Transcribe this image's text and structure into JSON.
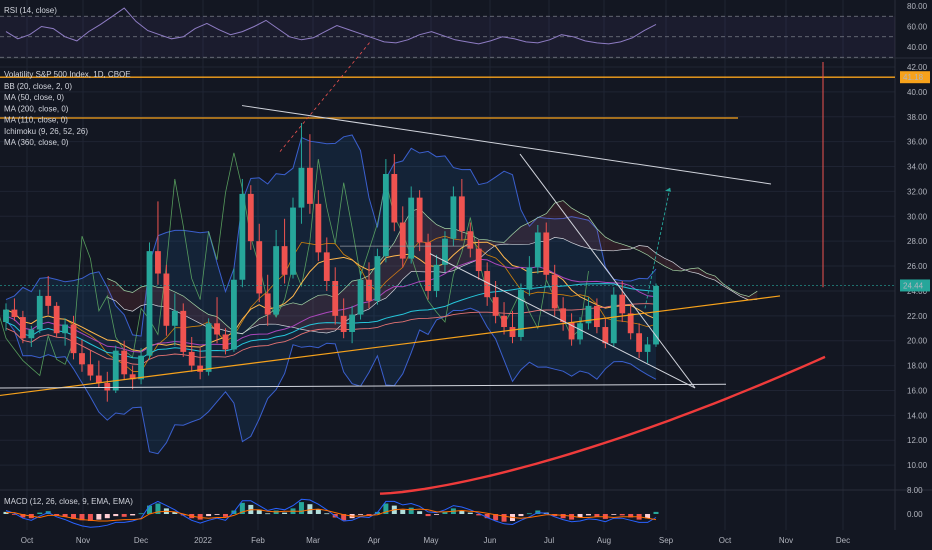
{
  "colors": {
    "background": "#131722",
    "grid": "#1f2433",
    "up": "#26a69a",
    "down": "#ef5350",
    "orange": "#f7a21b",
    "blue_band": "#3a5fcd",
    "rsi": "#8e7cc3",
    "white_line": "#d1d4dc",
    "red_curve": "#ef3b3b",
    "macd_line": "#2962ff",
    "signal_line": "#ff6d00",
    "price_tag": "#f7a21b"
  },
  "chart_data": [
    {
      "type": "line",
      "name": "rsi-panel",
      "title": "RSI (14, close)",
      "ylim": [
        38,
        80
      ],
      "ticks": [
        "80.00",
        "60.00",
        "40.00"
      ],
      "levels": [
        70,
        50,
        30
      ],
      "values": [
        55,
        48,
        52,
        60,
        58,
        50,
        46,
        55,
        62,
        70,
        78,
        65,
        56,
        52,
        48,
        50,
        58,
        63,
        57,
        52,
        55,
        60,
        66,
        58,
        50,
        47,
        49,
        55,
        61,
        57,
        53,
        49,
        45,
        44,
        47,
        52,
        55,
        51,
        47,
        45,
        43,
        46,
        50,
        48,
        45,
        44,
        47,
        52,
        50,
        46,
        44,
        43,
        45,
        49,
        56,
        62
      ]
    },
    {
      "type": "candlestick",
      "name": "price-panel",
      "title": "Volatility S&P 500 Index, 1D, CBOE",
      "indicators": [
        "BB (20, close, 2, 0)",
        "MA (50, close, 0)",
        "MA (200, close, 0)",
        "MA (110, close, 0)",
        "Ichimoku (9, 26, 52, 26)",
        "MA (360, close, 0)"
      ],
      "ylim": [
        7,
        43
      ],
      "y_ticks": [
        "42.00",
        "40.00",
        "38.00",
        "36.00",
        "34.00",
        "32.00",
        "30.00",
        "28.00",
        "26.00",
        "24.00",
        "22.00",
        "20.00",
        "18.00",
        "16.00",
        "14.00",
        "12.00",
        "10.00",
        "8.00"
      ],
      "x_labels": [
        "Oct",
        "Nov",
        "Dec",
        "2022",
        "Feb",
        "Mar",
        "Apr",
        "May",
        "Jun",
        "Jul",
        "Aug",
        "Sep",
        "Oct",
        "Nov",
        "Dec"
      ],
      "price_tags": [
        "41.18",
        "24.44"
      ],
      "horizontal_levels": [
        41.18,
        37.9
      ],
      "candles": [
        [
          21.5,
          23.0,
          20.8,
          22.5
        ],
        [
          22.5,
          23.4,
          21.6,
          21.9
        ],
        [
          21.9,
          22.4,
          19.8,
          20.2
        ],
        [
          20.2,
          21.2,
          19.5,
          20.9
        ],
        [
          20.9,
          24.1,
          20.6,
          23.6
        ],
        [
          23.6,
          25.2,
          22.1,
          22.8
        ],
        [
          22.8,
          23.1,
          20.3,
          20.6
        ],
        [
          20.6,
          21.8,
          19.6,
          21.3
        ],
        [
          21.3,
          22.0,
          18.5,
          19.0
        ],
        [
          19.0,
          20.1,
          17.5,
          18.1
        ],
        [
          18.1,
          19.2,
          16.8,
          17.2
        ],
        [
          17.2,
          18.4,
          16.2,
          16.6
        ],
        [
          16.6,
          17.5,
          15.1,
          16.0
        ],
        [
          16.0,
          19.6,
          15.8,
          19.2
        ],
        [
          19.2,
          20.0,
          16.9,
          17.3
        ],
        [
          17.3,
          18.0,
          16.1,
          16.9
        ],
        [
          16.9,
          19.4,
          16.5,
          18.8
        ],
        [
          18.8,
          27.9,
          18.5,
          27.2
        ],
        [
          27.2,
          31.2,
          24.5,
          25.4
        ],
        [
          25.4,
          26.1,
          20.4,
          21.2
        ],
        [
          21.2,
          23.8,
          19.6,
          22.4
        ],
        [
          22.4,
          23.0,
          18.7,
          19.1
        ],
        [
          19.1,
          20.3,
          17.5,
          18.0
        ],
        [
          18.0,
          19.4,
          16.9,
          17.5
        ],
        [
          17.5,
          21.8,
          17.2,
          21.4
        ],
        [
          21.4,
          23.5,
          19.8,
          20.5
        ],
        [
          20.5,
          21.0,
          18.9,
          19.3
        ],
        [
          19.3,
          25.8,
          19.1,
          24.9
        ],
        [
          24.9,
          33.0,
          24.3,
          31.8
        ],
        [
          31.8,
          32.5,
          27.3,
          28.0
        ],
        [
          28.0,
          29.4,
          23.1,
          23.8
        ],
        [
          23.8,
          25.3,
          21.2,
          22.1
        ],
        [
          22.1,
          28.9,
          21.9,
          27.6
        ],
        [
          27.6,
          29.8,
          24.6,
          25.3
        ],
        [
          25.3,
          31.5,
          25.0,
          30.7
        ],
        [
          30.7,
          37.5,
          29.4,
          33.9
        ],
        [
          33.9,
          36.6,
          30.2,
          31.0
        ],
        [
          31.0,
          32.1,
          26.4,
          27.1
        ],
        [
          27.1,
          28.3,
          24.0,
          24.8
        ],
        [
          24.8,
          25.9,
          21.3,
          22.0
        ],
        [
          22.0,
          23.4,
          20.2,
          20.7
        ],
        [
          20.7,
          22.8,
          19.8,
          22.1
        ],
        [
          22.1,
          25.6,
          21.7,
          24.9
        ],
        [
          24.9,
          26.3,
          22.6,
          23.2
        ],
        [
          23.2,
          27.4,
          22.9,
          26.8
        ],
        [
          26.8,
          34.6,
          26.3,
          33.4
        ],
        [
          33.4,
          35.0,
          28.8,
          29.5
        ],
        [
          29.5,
          30.8,
          25.9,
          26.6
        ],
        [
          26.6,
          32.4,
          26.2,
          31.5
        ],
        [
          31.5,
          32.1,
          27.2,
          27.9
        ],
        [
          27.9,
          28.6,
          23.3,
          24.0
        ],
        [
          24.0,
          26.9,
          23.5,
          26.1
        ],
        [
          26.1,
          28.8,
          25.5,
          28.2
        ],
        [
          28.2,
          32.4,
          27.6,
          31.6
        ],
        [
          31.6,
          33.0,
          28.1,
          28.8
        ],
        [
          28.8,
          29.5,
          26.7,
          27.4
        ],
        [
          27.4,
          28.1,
          24.9,
          25.6
        ],
        [
          25.6,
          26.3,
          22.8,
          23.5
        ],
        [
          23.5,
          24.8,
          21.4,
          22.0
        ],
        [
          22.0,
          23.1,
          20.5,
          21.1
        ],
        [
          21.1,
          22.4,
          19.8,
          20.3
        ],
        [
          20.3,
          24.6,
          20.0,
          24.1
        ],
        [
          24.1,
          26.8,
          23.6,
          25.9
        ],
        [
          25.9,
          29.3,
          25.4,
          28.7
        ],
        [
          28.7,
          29.5,
          24.9,
          25.3
        ],
        [
          25.3,
          26.1,
          22.0,
          22.6
        ],
        [
          22.6,
          23.5,
          20.8,
          21.5
        ],
        [
          21.5,
          22.2,
          19.6,
          20.1
        ],
        [
          20.1,
          21.9,
          19.7,
          21.4
        ],
        [
          21.4,
          23.5,
          20.9,
          22.8
        ],
        [
          22.8,
          23.4,
          20.6,
          21.1
        ],
        [
          21.1,
          21.8,
          19.4,
          19.8
        ],
        [
          19.8,
          24.3,
          19.5,
          23.7
        ],
        [
          23.7,
          24.8,
          21.5,
          22.2
        ],
        [
          22.2,
          22.9,
          20.1,
          20.6
        ],
        [
          20.6,
          21.4,
          18.6,
          19.1
        ],
        [
          19.1,
          20.3,
          18.2,
          19.7
        ],
        [
          19.7,
          24.6,
          19.5,
          24.4
        ]
      ]
    },
    {
      "type": "bar",
      "name": "macd-panel",
      "title": "MACD (12, 26, close, 9, EMA, EMA)",
      "ticks": [
        "0.00"
      ],
      "ylim": [
        -2.5,
        2.5
      ],
      "histogram": [
        0.3,
        -0.1,
        -0.5,
        -0.6,
        0.2,
        0.4,
        -0.2,
        -0.4,
        -0.7,
        -0.9,
        -1.0,
        -0.8,
        -0.6,
        -0.3,
        -0.4,
        -0.2,
        0.1,
        1.2,
        1.5,
        0.8,
        0.3,
        -0.2,
        -0.6,
        -0.8,
        -0.3,
        -0.1,
        -0.4,
        0.5,
        1.6,
        1.3,
        0.6,
        0.1,
        0.5,
        0.2,
        0.8,
        1.7,
        1.4,
        0.7,
        0.1,
        -0.5,
        -0.9,
        -0.6,
        -0.1,
        -0.3,
        0.3,
        1.5,
        1.2,
        0.6,
        0.9,
        0.4,
        -0.3,
        -0.1,
        0.3,
        0.8,
        0.5,
        0.2,
        -0.2,
        -0.6,
        -0.9,
        -1.1,
        -1.0,
        -0.3,
        0.1,
        0.5,
        0.2,
        -0.3,
        -0.6,
        -0.8,
        -0.5,
        -0.2,
        -0.4,
        -0.7,
        -0.1,
        -0.2,
        -0.5,
        -0.8,
        -0.6,
        0.3
      ],
      "macd": [
        0.5,
        0.1,
        -0.6,
        -0.9,
        -0.3,
        0.2,
        -0.4,
        -0.8,
        -1.3,
        -1.7,
        -1.9,
        -1.8,
        -1.6,
        -1.2,
        -1.2,
        -1.0,
        -0.6,
        1.2,
        1.8,
        1.2,
        0.6,
        -0.2,
        -0.9,
        -1.3,
        -0.9,
        -0.6,
        -0.9,
        0.3,
        1.9,
        1.9,
        1.2,
        0.5,
        0.8,
        0.6,
        1.2,
        2.1,
        2.0,
        1.4,
        0.6,
        -0.3,
        -1.0,
        -0.9,
        -0.4,
        -0.5,
        0.2,
        1.8,
        1.8,
        1.3,
        1.5,
        1.1,
        0.3,
        0.2,
        0.6,
        1.2,
        1.0,
        0.6,
        0.1,
        -0.5,
        -1.0,
        -1.4,
        -1.5,
        -0.9,
        -0.4,
        0.2,
        0.1,
        -0.4,
        -0.8,
        -1.1,
        -1.0,
        -0.7,
        -0.8,
        -1.1,
        -0.6,
        -0.6,
        -0.9,
        -1.2,
        -1.2,
        -0.5
      ],
      "signal": [
        0.2,
        0.2,
        -0.1,
        -0.3,
        -0.5,
        -0.2,
        -0.2,
        -0.4,
        -0.6,
        -0.8,
        -0.9,
        -1.0,
        -1.0,
        -0.9,
        -0.8,
        -0.8,
        -0.7,
        0.0,
        0.3,
        0.4,
        0.3,
        0.0,
        -0.3,
        -0.5,
        -0.6,
        -0.5,
        -0.5,
        -0.2,
        0.3,
        0.6,
        0.6,
        0.4,
        0.3,
        0.4,
        0.4,
        0.4,
        0.6,
        0.7,
        0.5,
        0.2,
        -0.1,
        -0.3,
        -0.3,
        -0.2,
        -0.1,
        0.3,
        0.6,
        0.7,
        0.6,
        0.7,
        0.6,
        0.3,
        0.3,
        0.4,
        0.5,
        0.4,
        0.3,
        0.1,
        -0.1,
        -0.3,
        -0.5,
        -0.6,
        -0.5,
        -0.3,
        -0.1,
        -0.1,
        -0.2,
        -0.3,
        -0.5,
        -0.5,
        -0.4,
        -0.4,
        -0.5,
        -0.4,
        -0.4,
        -0.4,
        -0.6,
        -0.8
      ]
    }
  ]
}
